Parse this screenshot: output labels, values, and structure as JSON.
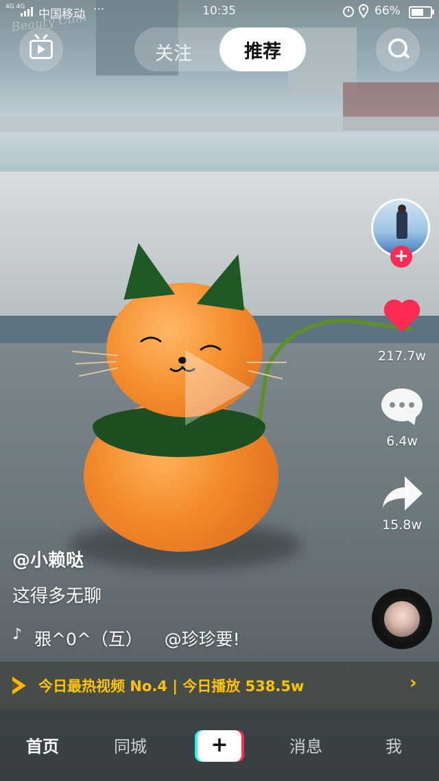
{
  "status_bar": {
    "network": "4G 4G",
    "carrier": "中国移动",
    "dots": "···",
    "time": "10:35",
    "battery_percent": "66%",
    "battery_level": 0.66
  },
  "watermark": "Beauty Cam",
  "top_nav": {
    "tabs": [
      "关注",
      "推荐"
    ],
    "active_tab": "推荐"
  },
  "video": {
    "author": "@小赖哒",
    "caption": "这得多无聊",
    "music": "㸧^0^（互）    @珍珍要!"
  },
  "stats": {
    "likes": "217.7w",
    "comments": "6.4w",
    "shares": "15.8w"
  },
  "hot_banner": {
    "text": "今日最热视频 No.4 | 今日播放 538.5w",
    "chevron": "›"
  },
  "bottom_tabs": {
    "home": "首页",
    "city": "同城",
    "create": "+",
    "messages": "消息",
    "me": "我"
  },
  "colors": {
    "like": "#fe2c55",
    "banner_text": "#ffc300",
    "create_cyan": "#25f4ee"
  }
}
